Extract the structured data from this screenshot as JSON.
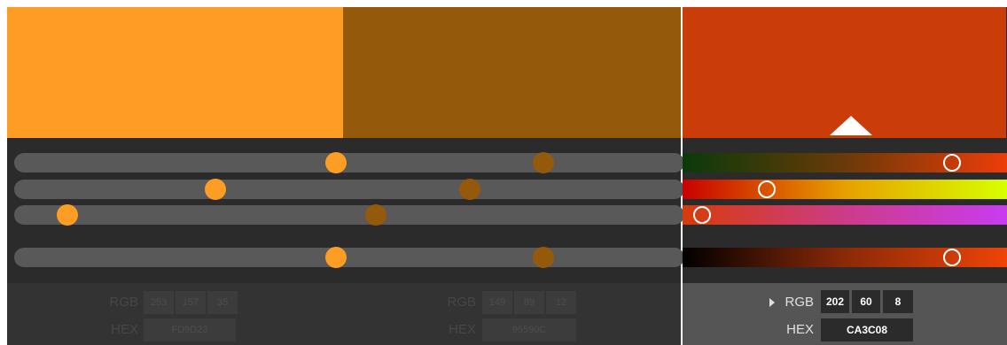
{
  "colors": {
    "swatch_1": "#FD9D23",
    "swatch_2": "#95590C",
    "swatch_3": "#CA3C08",
    "thumb_1": "#FD9D23",
    "thumb_2": "#95590C"
  },
  "color_1": {
    "rgb_label": "RGB",
    "hex_label": "HEX",
    "r": "253",
    "g": "157",
    "b": "35",
    "hex": "FD9D23"
  },
  "color_2": {
    "rgb_label": "RGB",
    "hex_label": "HEX",
    "r": "149",
    "g": "89",
    "b": "12",
    "hex": "95590C"
  },
  "color_3": {
    "rgb_label": "RGB",
    "hex_label": "HEX",
    "r": "202",
    "g": "60",
    "b": "8",
    "hex": "CA3C08",
    "expand_icon": "caret-right-icon"
  },
  "slider_levels": {
    "color_1": [
      0.48,
      0.3,
      0.08,
      0.48
    ],
    "color_2": [
      0.79,
      0.68,
      0.54,
      0.79
    ],
    "color_3": [
      0.83,
      0.26,
      0.06,
      0.83
    ]
  }
}
